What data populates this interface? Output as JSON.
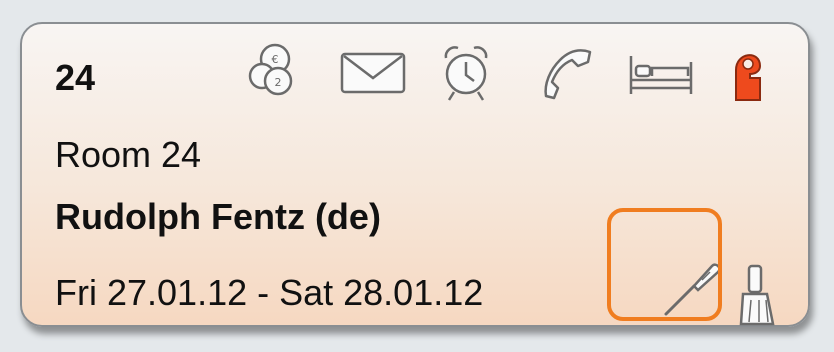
{
  "room": {
    "number": "24",
    "name": "Room 24",
    "guest": "Rudolph Fentz (de)",
    "dates": "Fri 27.01.12 - Sat 28.01.12"
  },
  "icons": [
    "coins-icon",
    "mail-icon",
    "alarm-clock-icon",
    "phone-icon",
    "bed-icon",
    "door-hanger-icon",
    "screwdriver-icon",
    "broom-icon"
  ],
  "colors": {
    "card_bg_top": "#f8f5f3",
    "card_bg_bottom": "#f6d8c1",
    "door_hanger": "#ee4a1d",
    "highlight": "#f07d20",
    "icon_stroke": "#6b6b6b"
  }
}
